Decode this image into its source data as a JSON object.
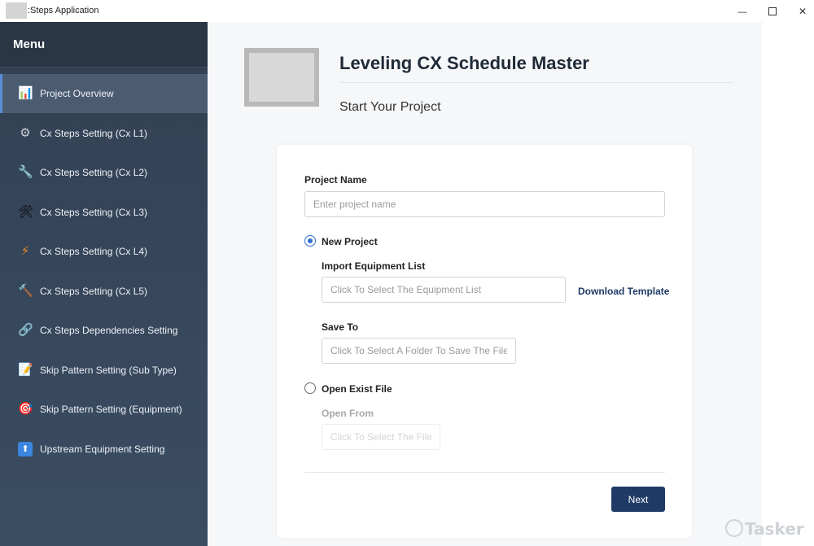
{
  "window": {
    "title": ":Steps Application",
    "minimize_glyph": "—",
    "close_glyph": "✕"
  },
  "sidebar": {
    "header": "Menu",
    "items": [
      {
        "label": "Project Overview",
        "icon": "chart-icon",
        "glyph": "📊",
        "active": true
      },
      {
        "label": "Cx Steps Setting (Cx L1)",
        "icon": "gear-icon",
        "glyph": "⚙"
      },
      {
        "label": "Cx Steps Setting (Cx L2)",
        "icon": "wrench-icon",
        "glyph": "🔧"
      },
      {
        "label": "Cx Steps Setting (Cx L3)",
        "icon": "tools-icon",
        "glyph": "🛠"
      },
      {
        "label": "Cx Steps Setting (Cx L4)",
        "icon": "lightning-icon",
        "glyph": "⚡"
      },
      {
        "label": "Cx Steps Setting (Cx L5)",
        "icon": "hammer-icon",
        "glyph": "🔨"
      },
      {
        "label": "Cx Steps Dependencies Setting",
        "icon": "link-icon",
        "glyph": "🔗"
      },
      {
        "label": "Skip Pattern Setting (Sub Type)",
        "icon": "document-icon",
        "glyph": "📝"
      },
      {
        "label": "Skip Pattern Setting (Equipment)",
        "icon": "target-icon",
        "glyph": "🎯"
      },
      {
        "label": "Upstream Equipment Setting",
        "icon": "up-arrow-icon",
        "glyph": "⬆"
      }
    ]
  },
  "main": {
    "title": "Leveling CX Schedule Master",
    "subtitle": "Start Your Project"
  },
  "form": {
    "project_name_label": "Project Name",
    "project_name_placeholder": "Enter project name",
    "new_project_label": "New Project",
    "new_project_selected": true,
    "import_label": "Import Equipment List",
    "import_placeholder": "Click To Select The Equipment List",
    "download_template": "Download Template",
    "save_to_label": "Save To",
    "save_to_placeholder": "Click To Select A Folder To Save The File",
    "open_exist_label": "Open Exist File",
    "open_from_label": "Open From",
    "open_from_placeholder": "Click To Select The File",
    "next_label": "Next"
  },
  "watermark": "Tasker",
  "colors": {
    "sidebar": "#324053",
    "accent": "#1f3a66",
    "radio": "#2f6fd0"
  }
}
